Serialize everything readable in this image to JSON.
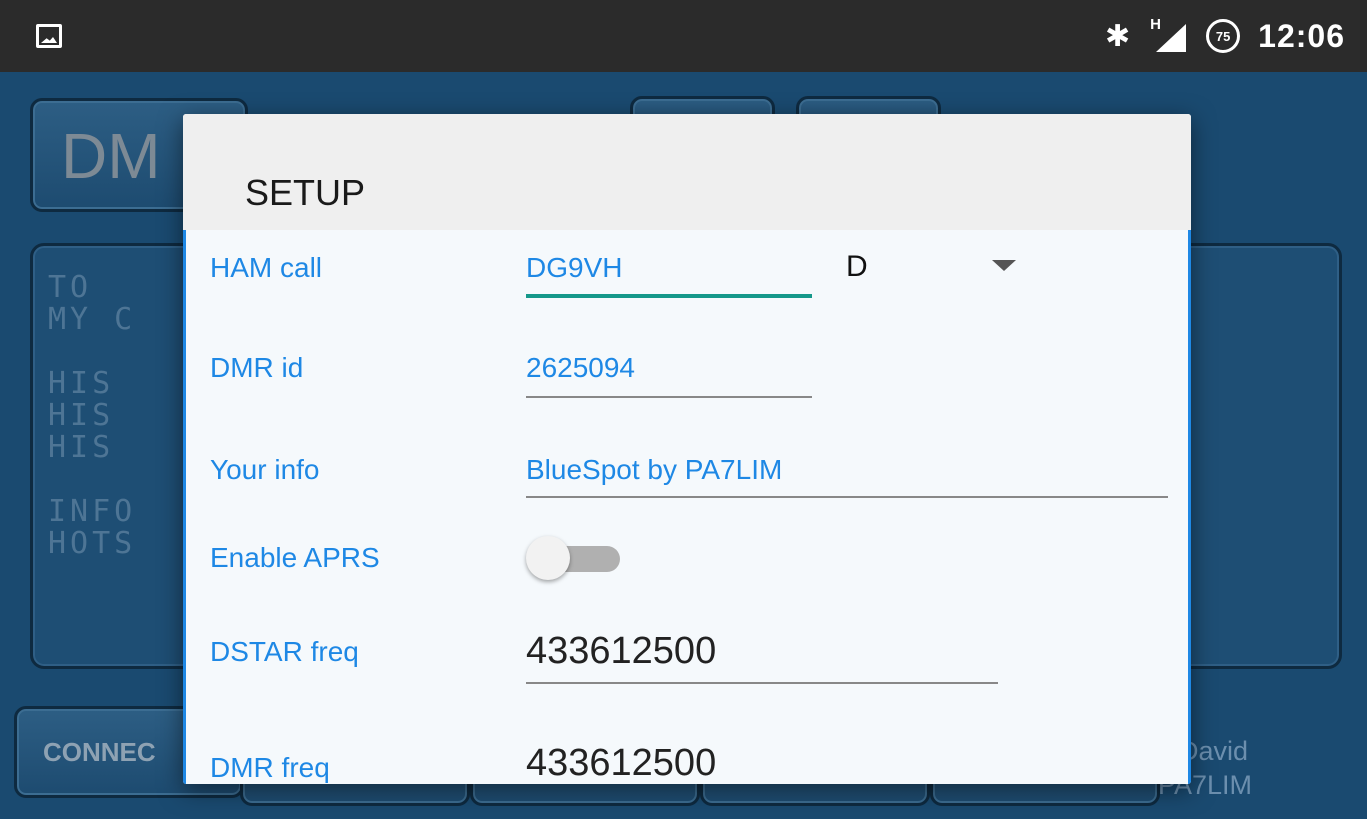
{
  "status_bar": {
    "bluetooth_icon": "bluetooth-icon",
    "signal_label": "H",
    "battery_level": "75",
    "time": "12:06"
  },
  "background": {
    "mode_label": "DM",
    "display_lines": "TO\nMY C\n\nHIS \nHIS\nHIS\n\nINFO\nHOTS",
    "connect_label": "CONNEC",
    "credit_line1": "y David",
    "credit_line2": "PA7LIM"
  },
  "dialog": {
    "title": "SETUP",
    "ham_call": {
      "label": "HAM call",
      "value": "DG9VH",
      "suffix": "D"
    },
    "dmr_id": {
      "label": "DMR id",
      "value": "2625094"
    },
    "your_info": {
      "label": "Your info",
      "value": "BlueSpot by PA7LIM"
    },
    "enable_aprs": {
      "label": "Enable APRS",
      "enabled": false
    },
    "dstar_freq": {
      "label": "DSTAR freq",
      "value": "433612500"
    },
    "dmr_freq": {
      "label": "DMR freq",
      "value": "433612500"
    }
  },
  "colors": {
    "accent": "#1e88e5",
    "focus_underline": "#15988a",
    "status_bar": "#2b2b2b",
    "app_background": "#1a4a70"
  }
}
